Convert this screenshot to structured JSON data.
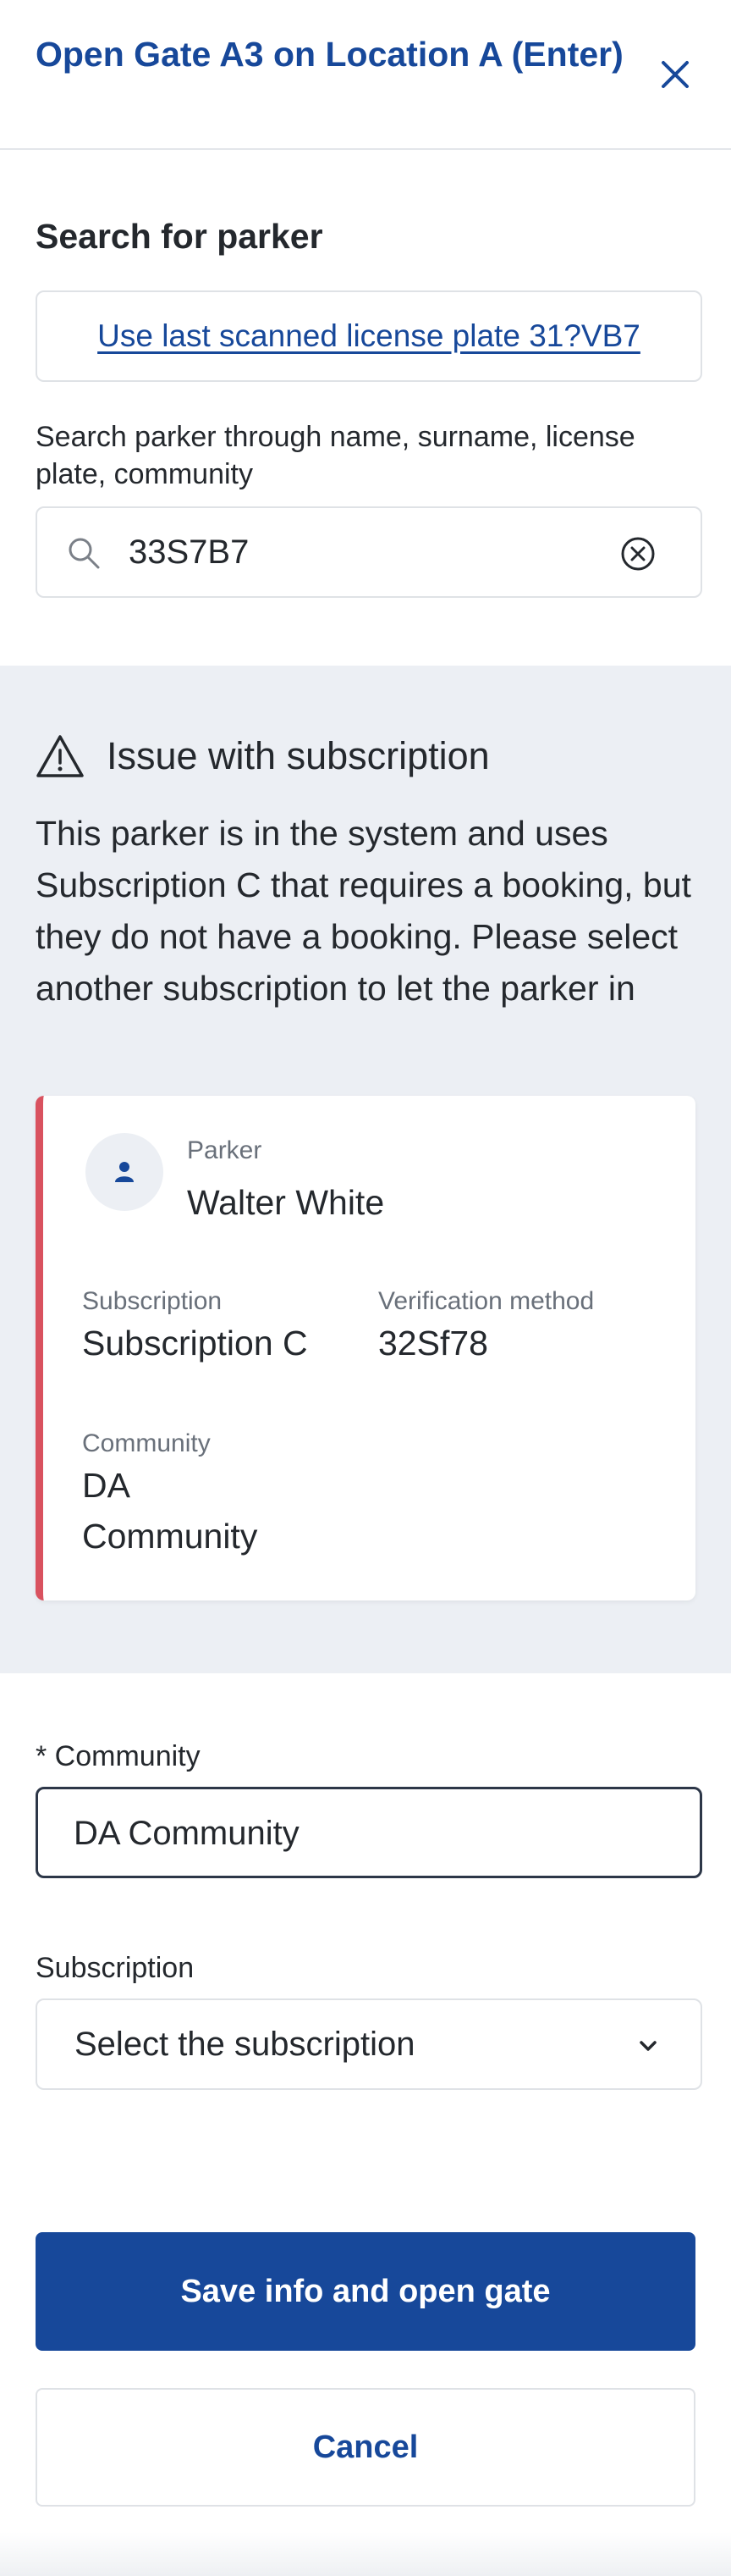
{
  "header": {
    "title": "Open Gate A3 on Location A (Enter)",
    "close_icon": "close-icon"
  },
  "search": {
    "heading": "Search for parker",
    "last_scanned_link": "Use last scanned license plate 31?VB7",
    "label": "Search parker through name, surname, license plate, community",
    "value": "33S7B7",
    "search_icon": "search-icon",
    "clear_icon": "clear-circle-icon"
  },
  "issue": {
    "icon": "warning-icon",
    "title": "Issue with subscription",
    "message": "This parker is in the system and uses Subscription C that requires a booking, but they do not have a booking. Please select another subscription to let the parker in",
    "accent_color": "#d9525f"
  },
  "parker_card": {
    "avatar_icon": "user-icon",
    "parker_label": "Parker",
    "parker_name": "Walter White",
    "subscription_label": "Subscription",
    "subscription_value": "Subscription C",
    "verification_label": "Verification method",
    "verification_value": "32Sf78",
    "community_label": "Community",
    "community_value": "DA Community"
  },
  "form": {
    "community_label": "* Community",
    "community_value": "DA Community",
    "subscription_label": "Subscription",
    "subscription_placeholder": "Select the subscription",
    "chevron_icon": "chevron-down-icon"
  },
  "actions": {
    "save_label": "Save info and open gate",
    "cancel_label": "Cancel",
    "primary_color": "#17489a"
  }
}
